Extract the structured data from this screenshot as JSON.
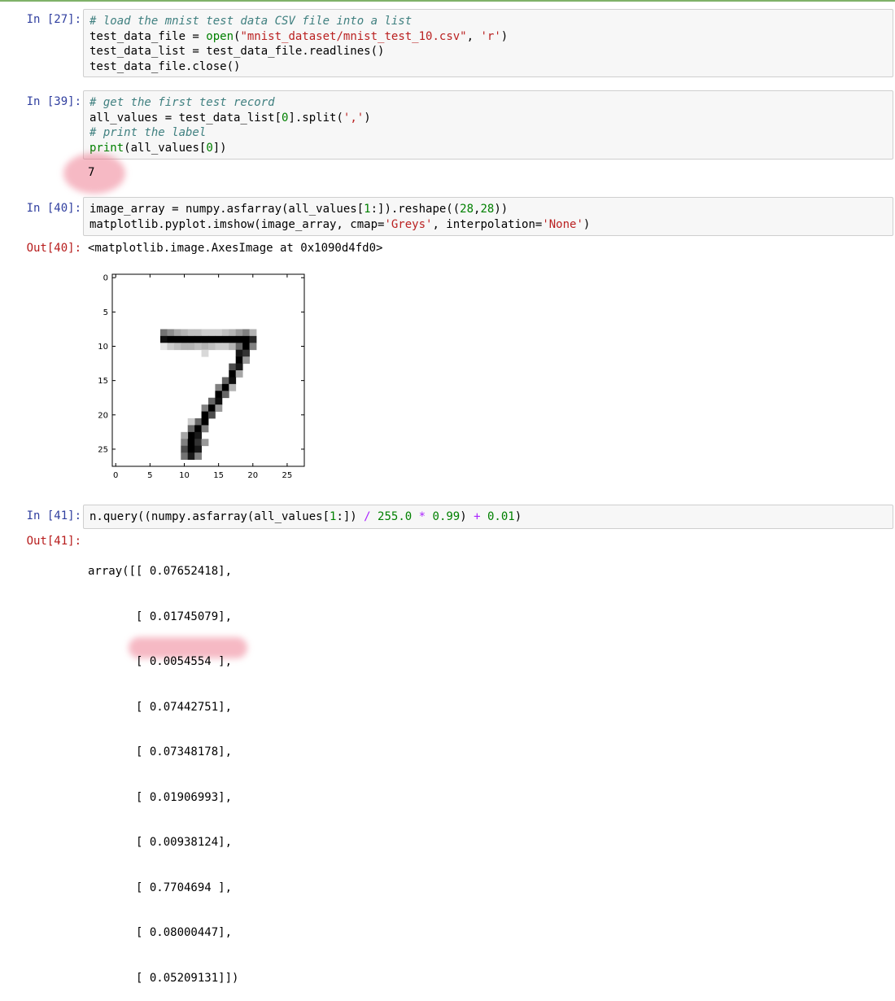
{
  "cells": {
    "c27": {
      "prompt": "In [27]:",
      "comment1": "# load the mnist test data CSV file into a list",
      "l2_var": "test_data_file = ",
      "l2_open": "open",
      "l2_p1": "(",
      "l2_str1": "\"mnist_dataset/mnist_test_10.csv\"",
      "l2_sep": ", ",
      "l2_str2": "'r'",
      "l2_p2": ")",
      "line3": "test_data_list = test_data_file.readlines()",
      "line4": "test_data_file.close()"
    },
    "c39": {
      "prompt": "In [39]:",
      "comment1": "# get the first test record",
      "l2_a": "all_values = test_data_list[",
      "l2_num": "0",
      "l2_b": "].split(",
      "l2_str": "','",
      "l2_c": ")",
      "comment2": "# print the label",
      "l4_print": "print",
      "l4_a": "(all_values[",
      "l4_num": "0",
      "l4_b": "])",
      "output": "7"
    },
    "c40": {
      "prompt": "In [40]:",
      "l1_a": "image_array = numpy.asfarray(all_values[",
      "l1_n1": "1",
      "l1_b": ":]).reshape((",
      "l1_n2": "28",
      "l1_c": ",",
      "l1_n3": "28",
      "l1_d": "))",
      "l2_a": "matplotlib.pyplot.imshow(image_array, cmap=",
      "l2_s1": "'Greys'",
      "l2_b": ", interpolation=",
      "l2_s2": "'None'",
      "l2_c": ")",
      "out_prompt": "Out[40]:",
      "out_text": "<matplotlib.image.AxesImage at 0x1090d4fd0>"
    },
    "c41": {
      "prompt": "In [41]:",
      "l1_a": "n.query((numpy.asfarray(all_values[",
      "l1_n1": "1",
      "l1_b": ":]) ",
      "l1_op1": "/",
      "l1_sp1": " ",
      "l1_n2": "255.0",
      "l1_sp2": " ",
      "l1_op2": "*",
      "l1_sp3": " ",
      "l1_n3": "0.99",
      "l1_c": ") ",
      "l1_op3": "+",
      "l1_sp4": " ",
      "l1_n4": "0.01",
      "l1_d": ")",
      "out_prompt": "Out[41]:",
      "out_lines": [
        "array([[ 0.07652418],",
        "       [ 0.01745079],",
        "       [ 0.0054554 ],",
        "       [ 0.07442751],",
        "       [ 0.07348178],",
        "       [ 0.01906993],",
        "       [ 0.00938124],",
        "       [ 0.7704694 ],",
        "       [ 0.08000447],",
        "       [ 0.05209131]])"
      ]
    }
  },
  "plot": {
    "xticks": [
      "0",
      "5",
      "10",
      "15",
      "20",
      "25"
    ],
    "yticks": [
      "0",
      "5",
      "10",
      "15",
      "20",
      "25"
    ],
    "pixels": [
      [
        8,
        7,
        0.55
      ],
      [
        8,
        8,
        0.45
      ],
      [
        8,
        9,
        0.35
      ],
      [
        8,
        10,
        0.3
      ],
      [
        8,
        11,
        0.25
      ],
      [
        8,
        12,
        0.25
      ],
      [
        8,
        13,
        0.2
      ],
      [
        8,
        14,
        0.2
      ],
      [
        8,
        15,
        0.2
      ],
      [
        8,
        16,
        0.25
      ],
      [
        8,
        17,
        0.3
      ],
      [
        8,
        18,
        0.4
      ],
      [
        8,
        19,
        0.5
      ],
      [
        8,
        20,
        0.3
      ],
      [
        9,
        7,
        0.95
      ],
      [
        9,
        8,
        1.0
      ],
      [
        9,
        9,
        1.0
      ],
      [
        9,
        10,
        1.0
      ],
      [
        9,
        11,
        1.0
      ],
      [
        9,
        12,
        1.0
      ],
      [
        9,
        13,
        1.0
      ],
      [
        9,
        14,
        1.0
      ],
      [
        9,
        15,
        1.0
      ],
      [
        9,
        16,
        1.0
      ],
      [
        9,
        17,
        1.0
      ],
      [
        9,
        18,
        1.0
      ],
      [
        9,
        19,
        1.0
      ],
      [
        9,
        20,
        0.85
      ],
      [
        10,
        7,
        0.1
      ],
      [
        10,
        8,
        0.2
      ],
      [
        10,
        9,
        0.25
      ],
      [
        10,
        10,
        0.3
      ],
      [
        10,
        11,
        0.3
      ],
      [
        10,
        12,
        0.25
      ],
      [
        10,
        13,
        0.3
      ],
      [
        10,
        14,
        0.25
      ],
      [
        10,
        15,
        0.2
      ],
      [
        10,
        16,
        0.2
      ],
      [
        10,
        17,
        0.3
      ],
      [
        10,
        18,
        0.6
      ],
      [
        10,
        19,
        1.0
      ],
      [
        10,
        20,
        0.5
      ],
      [
        11,
        18,
        0.9
      ],
      [
        11,
        19,
        0.8
      ],
      [
        11,
        13,
        0.15
      ],
      [
        12,
        18,
        1.0
      ],
      [
        12,
        19,
        0.4
      ],
      [
        13,
        17,
        0.7
      ],
      [
        13,
        18,
        0.9
      ],
      [
        14,
        17,
        1.0
      ],
      [
        14,
        18,
        0.35
      ],
      [
        15,
        16,
        0.6
      ],
      [
        15,
        17,
        0.95
      ],
      [
        16,
        15,
        0.5
      ],
      [
        16,
        16,
        1.0
      ],
      [
        16,
        17,
        0.3
      ],
      [
        17,
        15,
        1.0
      ],
      [
        17,
        16,
        0.6
      ],
      [
        18,
        14,
        0.6
      ],
      [
        18,
        15,
        0.95
      ],
      [
        19,
        13,
        0.5
      ],
      [
        19,
        14,
        1.0
      ],
      [
        19,
        15,
        0.4
      ],
      [
        20,
        13,
        1.0
      ],
      [
        20,
        14,
        0.7
      ],
      [
        21,
        12,
        0.6
      ],
      [
        21,
        13,
        1.0
      ],
      [
        21,
        11,
        0.2
      ],
      [
        22,
        11,
        0.6
      ],
      [
        22,
        12,
        1.0
      ],
      [
        22,
        13,
        0.5
      ],
      [
        23,
        11,
        1.0
      ],
      [
        23,
        12,
        0.9
      ],
      [
        23,
        10,
        0.35
      ],
      [
        24,
        10,
        0.5
      ],
      [
        24,
        11,
        1.0
      ],
      [
        24,
        12,
        0.8
      ],
      [
        24,
        13,
        0.4
      ],
      [
        25,
        10,
        0.7
      ],
      [
        25,
        11,
        1.0
      ],
      [
        25,
        12,
        0.9
      ],
      [
        26,
        10,
        0.55
      ],
      [
        26,
        11,
        0.9
      ],
      [
        26,
        12,
        0.5
      ]
    ]
  }
}
